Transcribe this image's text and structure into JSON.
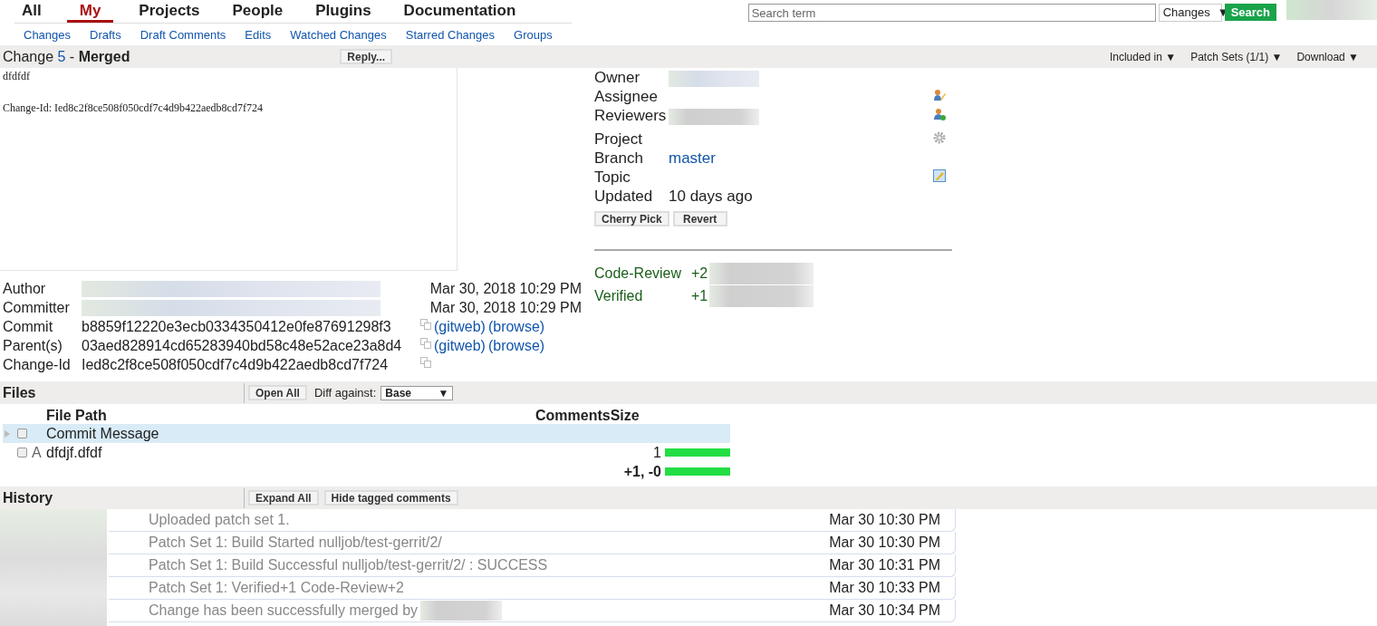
{
  "nav": {
    "tabs": [
      {
        "label": "All",
        "selected": false
      },
      {
        "label": "My",
        "selected": true
      },
      {
        "label": "Projects",
        "selected": false
      },
      {
        "label": "People",
        "selected": false
      },
      {
        "label": "Plugins",
        "selected": false
      },
      {
        "label": "Documentation",
        "selected": false
      }
    ],
    "subtabs": [
      "Changes",
      "Drafts",
      "Draft Comments",
      "Edits",
      "Watched Changes",
      "Starred Changes",
      "Groups"
    ]
  },
  "search": {
    "placeholder": "Search term",
    "scope": "Changes",
    "arrow": "▼",
    "button": "Search"
  },
  "change": {
    "label": "Change",
    "number": "5",
    "separator": "-",
    "status": "Merged",
    "reply": "Reply...",
    "menus": [
      "Included in ▼",
      "Patch Sets (1/1) ▼",
      "Download ▼"
    ]
  },
  "commit_message": [
    "dfdfdf",
    "Change-Id: Ied8c2f8ce508f050cdf7c4d9b422aedb8cd7f724"
  ],
  "info": [
    {
      "label": "Owner"
    },
    {
      "label": "Assignee"
    },
    {
      "label": "Reviewers"
    },
    {
      "label": "Project"
    },
    {
      "label": "Branch",
      "value": "master",
      "link": true
    },
    {
      "label": "Topic"
    },
    {
      "label": "Updated",
      "value": "10 days ago",
      "link": false
    }
  ],
  "actions": [
    "Cherry Pick",
    "Revert"
  ],
  "votes": [
    {
      "label": "Code-Review",
      "value": "+2"
    },
    {
      "label": "Verified",
      "value": "+1"
    }
  ],
  "commit_info": [
    {
      "label": "Author",
      "date": "Mar 30, 2018 10:29 PM"
    },
    {
      "label": "Committer",
      "date": "Mar 30, 2018 10:29 PM"
    },
    {
      "label": "Commit",
      "value": "b8859f12220e3ecb0334350412e0fe87691298f3",
      "links": [
        "(gitweb)",
        "(browse)"
      ]
    },
    {
      "label": "Parent(s)",
      "value": "03aed828914cd65283940bd58c48e52ace23a8d4",
      "links": [
        "(gitweb)",
        "(browse)"
      ]
    },
    {
      "label": "Change-Id",
      "value": "Ied8c2f8ce508f050cdf7c4d9b422aedb8cd7f724"
    }
  ],
  "files": {
    "title": "Files",
    "open_all": "Open All",
    "diff_label": "Diff against:",
    "diff_base": "Base",
    "diff_arrow": "▼",
    "columns": [
      "File Path",
      "Comments",
      "Size"
    ],
    "rows": [
      {
        "name": "Commit Message",
        "selected": true,
        "checked": false
      },
      {
        "name": "dfdjf.dfdf",
        "status": "A",
        "size": "1",
        "selected": false,
        "checked": false
      }
    ],
    "total": {
      "size": "+1, -0"
    }
  },
  "history": {
    "title": "History",
    "buttons": [
      "Expand All",
      "Hide tagged comments"
    ],
    "entries": [
      {
        "message": "Uploaded patch set 1.",
        "time": "Mar 30 10:30 PM"
      },
      {
        "message": "Patch Set 1: Build Started nulljob/test-gerrit/2/",
        "time": "Mar 30 10:30 PM"
      },
      {
        "message": "Patch Set 1: Build Successful nulljob/test-gerrit/2/ : SUCCESS",
        "time": "Mar 30 10:31 PM"
      },
      {
        "message": "Patch Set 1: Verified+1 Code-Review+2",
        "time": "Mar 30 10:33 PM"
      },
      {
        "message": "Change has been successfully merged by",
        "time": "Mar 30 10:34 PM",
        "redacted": true
      }
    ]
  }
}
